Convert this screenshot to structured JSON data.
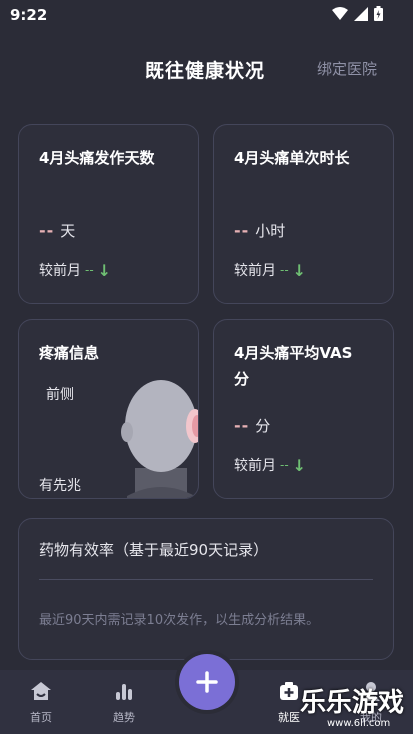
{
  "status": {
    "time": "9:22"
  },
  "header": {
    "title": "既往健康状况",
    "bind_hospital": "绑定医院"
  },
  "cards": {
    "attack_days": {
      "title": "4月头痛发作天数",
      "value": "--",
      "unit": "天",
      "compare_label": "较前月",
      "compare_value": "--"
    },
    "duration": {
      "title": "4月头痛单次时长",
      "value": "--",
      "unit": "小时",
      "compare_label": "较前月",
      "compare_value": "--"
    },
    "pain_info": {
      "title": "疼痛信息",
      "location": "前侧",
      "aura": "有先兆"
    },
    "vas": {
      "title_line1": "4月头痛平均VAS",
      "title_line2": "分",
      "value": "--",
      "unit": "分",
      "compare_label": "较前月",
      "compare_value": "--"
    }
  },
  "efficacy": {
    "title": "药物有效率（基于最近90天记录）",
    "note": "最近90天内需记录10次发作，以生成分析结果。"
  },
  "nav": {
    "home": "首页",
    "trend": "趋势",
    "clinic": "就医",
    "profile": "我的"
  },
  "watermark": {
    "main": "乐乐游戏",
    "sub": "www.6ll.com"
  },
  "colors": {
    "background": "#2b2c37",
    "accent": "#7b6fd6",
    "trend_green": "#6fbf73",
    "dash_pink": "#e6b1b4"
  }
}
